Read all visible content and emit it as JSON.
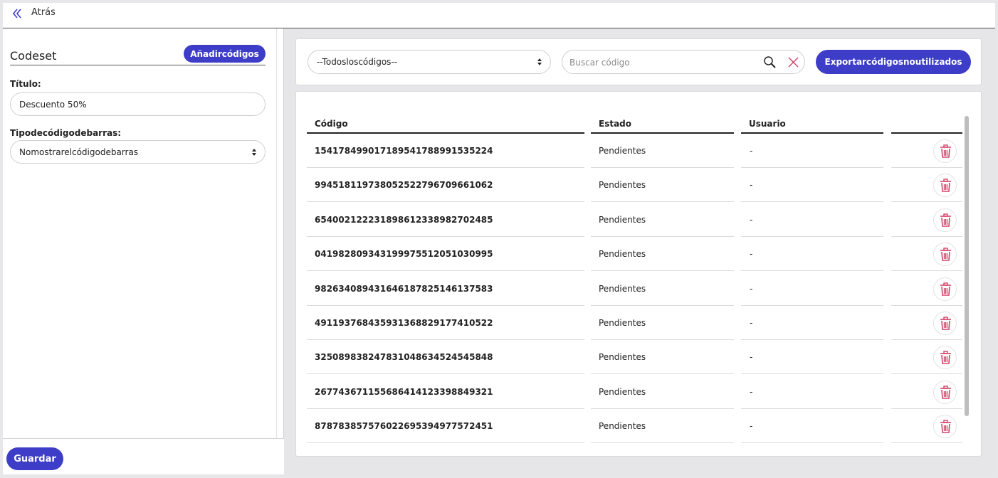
{
  "topbar": {
    "back_label": "Atrás"
  },
  "left_panel": {
    "section_title": "Codeset",
    "add_codes_label": "Añadir códigos",
    "title_label": "Título:",
    "title_value": "Descuento 50%",
    "barcode_label": "Tipo de código de barras:",
    "barcode_value": "No mostrar el código de barras",
    "save_label": "Guardar"
  },
  "filters": {
    "code_filter_value": "-- Todos los códigos --",
    "search_placeholder": "Buscar código",
    "search_value": "",
    "export_label": "Exportar códigos no utilizados"
  },
  "table": {
    "headers": [
      "Código",
      "Estado",
      "Usuario"
    ],
    "rows": [
      {
        "code": "15417849901718954178899153522 4",
        "status": "Pendientes",
        "user": "-"
      },
      {
        "code": "99451811973805252279670966106 2",
        "status": "Pendientes",
        "user": "-"
      },
      {
        "code": "65400212223189861233898270248 5",
        "status": "Pendientes",
        "user": "-"
      },
      {
        "code": "04198280934319997551205103099 5",
        "status": "Pendientes",
        "user": "-"
      },
      {
        "code": "98263408943164618782514613758 3",
        "status": "Pendientes",
        "user": "-"
      },
      {
        "code": "49119376843593136882917741052 2",
        "status": "Pendientes",
        "user": "-"
      },
      {
        "code": "32508983824783104863452454584 8",
        "status": "Pendientes",
        "user": "-"
      },
      {
        "code": "26774367115568641412339884932 1",
        "status": "Pendientes",
        "user": "-"
      },
      {
        "code": "87878385757602269539497757245 1",
        "status": "Pendientes",
        "user": "-"
      }
    ]
  },
  "colors": {
    "accent": "#3d3dc8",
    "delete": "#d0466a"
  }
}
